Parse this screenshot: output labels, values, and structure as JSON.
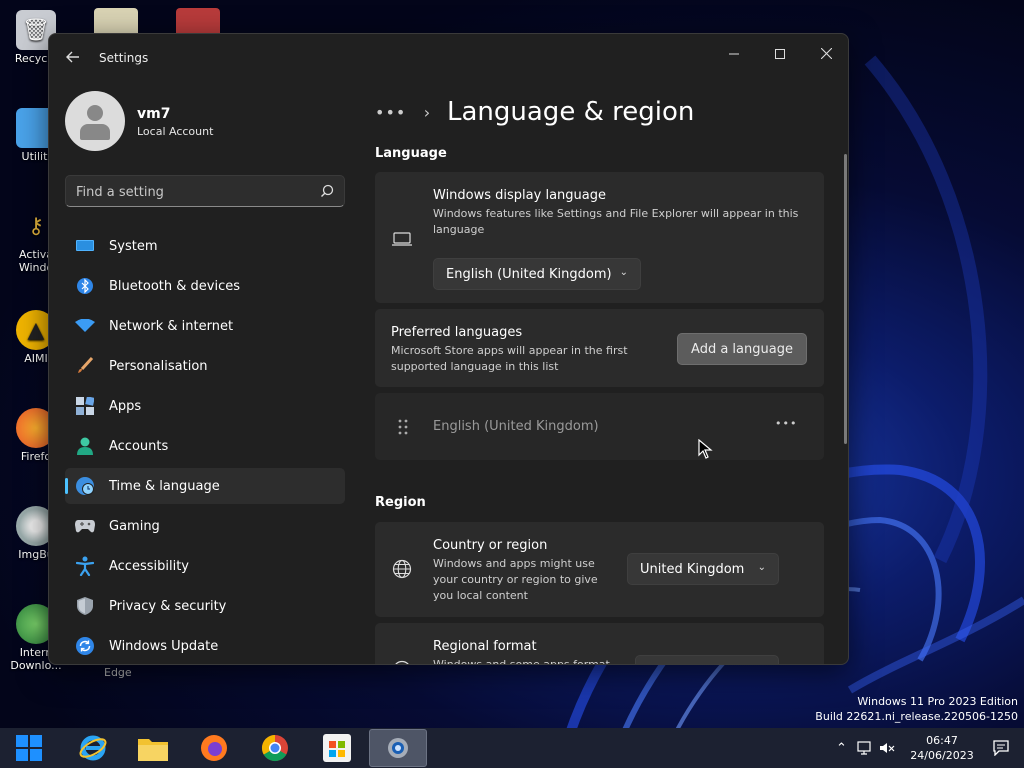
{
  "desktop": {
    "icons": [
      {
        "label": "Recycle",
        "icon": "recycle-bin-icon"
      },
      {
        "label": "Utiliti",
        "icon": "folder-icon"
      },
      {
        "label": "Activa\nWindo",
        "icon": "key-icon"
      },
      {
        "label": "AIMI",
        "icon": "aimp-icon"
      },
      {
        "label": "Firefo",
        "icon": "firefox-icon"
      },
      {
        "label": "ImgBu",
        "icon": "disc-icon"
      },
      {
        "label": "Intern\nDownlo...",
        "icon": "idm-icon"
      }
    ],
    "edge_label": "Edge"
  },
  "window": {
    "app_title": "Settings",
    "controls": {
      "minimize": "—",
      "maximize": "☐",
      "close": "✕"
    }
  },
  "profile": {
    "name": "vm7",
    "account_type": "Local Account"
  },
  "search": {
    "placeholder": "Find a setting"
  },
  "nav": {
    "items": [
      {
        "label": "System",
        "icon": "system-icon"
      },
      {
        "label": "Bluetooth & devices",
        "icon": "bluetooth-icon"
      },
      {
        "label": "Network & internet",
        "icon": "wifi-icon"
      },
      {
        "label": "Personalisation",
        "icon": "brush-icon"
      },
      {
        "label": "Apps",
        "icon": "apps-icon"
      },
      {
        "label": "Accounts",
        "icon": "accounts-icon"
      },
      {
        "label": "Time & language",
        "icon": "time-language-icon",
        "active": true
      },
      {
        "label": "Gaming",
        "icon": "gamepad-icon"
      },
      {
        "label": "Accessibility",
        "icon": "accessibility-icon"
      },
      {
        "label": "Privacy & security",
        "icon": "shield-icon"
      },
      {
        "label": "Windows Update",
        "icon": "update-icon"
      }
    ]
  },
  "breadcrumb": {
    "dots": "•••",
    "chevron": "›",
    "title": "Language & region"
  },
  "language": {
    "heading": "Language",
    "display": {
      "title": "Windows display language",
      "desc": "Windows features like Settings and File Explorer will appear in this language",
      "value": "English (United Kingdom)"
    },
    "preferred": {
      "title": "Preferred languages",
      "desc": "Microsoft Store apps will appear in the first supported language in this list",
      "button": "Add a language"
    },
    "installed": {
      "name": "English (United Kingdom)",
      "more": "•••"
    }
  },
  "region": {
    "heading": "Region",
    "country": {
      "title": "Country or region",
      "desc": "Windows and apps might use your country or region to give you local content",
      "value": "United Kingdom"
    },
    "format": {
      "title": "Regional format",
      "desc": "Windows and some apps format"
    }
  },
  "watermark": {
    "line1": "Windows 11 Pro 2023 Edition",
    "line2": "Build 22621.ni_release.220506-1250"
  },
  "taskbar": {
    "time": "06:47",
    "date": "24/06/2023"
  },
  "colors": {
    "accent": "#4cc2ff",
    "window_bg": "#202020",
    "card_bg": "#2b2b2b"
  }
}
